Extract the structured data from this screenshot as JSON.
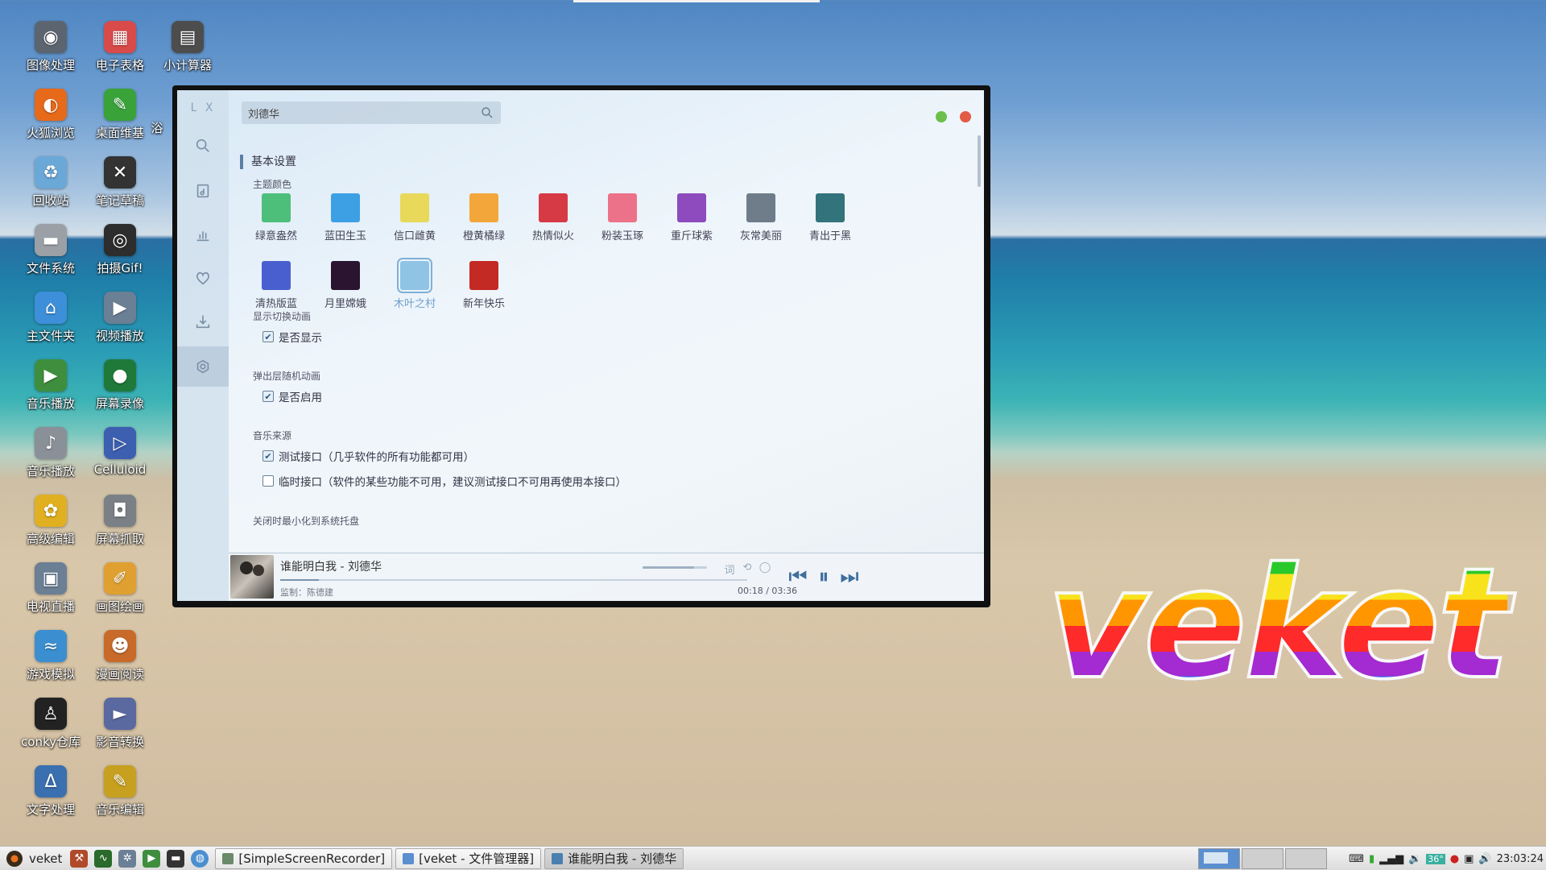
{
  "desktop": {
    "icons": [
      {
        "label": "图像处理",
        "icon": "image-editor-icon",
        "color": "#5c6470",
        "glyph": "◉"
      },
      {
        "label": "电子表格",
        "icon": "spreadsheet-icon",
        "color": "#d94a4a",
        "glyph": "▦"
      },
      {
        "label": "小计算器",
        "icon": "calculator-icon",
        "color": "#4d4d4d",
        "glyph": "▤"
      },
      {
        "label": "火狐浏览",
        "icon": "firefox-icon",
        "color": "#e66a1a",
        "glyph": "◐"
      },
      {
        "label": "桌面维基",
        "icon": "wiki-icon",
        "color": "#39a33a",
        "glyph": "✎"
      },
      {
        "label": "回收站",
        "icon": "trash-icon",
        "color": "#6aa8d8",
        "glyph": "♻"
      },
      {
        "label": "笔记草稿",
        "icon": "notes-icon",
        "color": "#333333",
        "glyph": "✕"
      },
      {
        "label": "文件系统",
        "icon": "drive-icon",
        "color": "#9aa0a6",
        "glyph": "▬"
      },
      {
        "label": "拍摄Gif!",
        "icon": "camera-icon",
        "color": "#2d2d2d",
        "glyph": "◎"
      },
      {
        "label": "主文件夹",
        "icon": "home-folder-icon",
        "color": "#3d8fd9",
        "glyph": "⌂"
      },
      {
        "label": "视频播放",
        "icon": "video-player-icon",
        "color": "#6b7f95",
        "glyph": "▶"
      },
      {
        "label": "音乐播放",
        "icon": "music-player-icon",
        "color": "#3e8e3e",
        "glyph": "▶"
      },
      {
        "label": "屏幕录像",
        "icon": "screen-recorder-icon",
        "color": "#1f7a3a",
        "glyph": "●"
      },
      {
        "label": "音乐播放",
        "icon": "speaker-icon",
        "color": "#8a9098",
        "glyph": "♪"
      },
      {
        "label": "Celluloid",
        "icon": "celluloid-icon",
        "color": "#3d5fb0",
        "glyph": "▷"
      },
      {
        "label": "高级编辑",
        "icon": "advanced-editor-icon",
        "color": "#e0b020",
        "glyph": "✿"
      },
      {
        "label": "屏幕抓取",
        "icon": "screenshot-icon",
        "color": "#7b7f86",
        "glyph": "◘"
      },
      {
        "label": "电视直播",
        "icon": "tv-icon",
        "color": "#6b7f95",
        "glyph": "▣"
      },
      {
        "label": "画图绘画",
        "icon": "paint-icon",
        "color": "#e0a030",
        "glyph": "✐"
      },
      {
        "label": "游戏模拟",
        "icon": "game-emulator-icon",
        "color": "#3b8fd0",
        "glyph": "≈"
      },
      {
        "label": "漫画阅读",
        "icon": "comic-reader-icon",
        "color": "#c86a2a",
        "glyph": "☻"
      },
      {
        "label": "conky仓库",
        "icon": "penguin-icon",
        "color": "#222222",
        "glyph": "♙"
      },
      {
        "label": "影音转换",
        "icon": "media-converter-icon",
        "color": "#5a6aa0",
        "glyph": "►"
      },
      {
        "label": "文字处理",
        "icon": "word-processor-icon",
        "color": "#3a6fb0",
        "glyph": "Δ"
      },
      {
        "label": "音乐编辑",
        "icon": "music-editor-icon",
        "color": "#c8a020",
        "glyph": "✎"
      }
    ],
    "partial_label": "浴"
  },
  "app": {
    "logo": "L X",
    "search_value": "刘德华",
    "section_title": "基本设置",
    "theme_label": "主题颜色",
    "themes": [
      {
        "name": "绿意盎然",
        "color": "#4dbf7a"
      },
      {
        "name": "蓝田生玉",
        "color": "#3ea0e4"
      },
      {
        "name": "信口雌黄",
        "color": "#e9d95a"
      },
      {
        "name": "橙黄橘绿",
        "color": "#f3a73b"
      },
      {
        "name": "热情似火",
        "color": "#d63a45"
      },
      {
        "name": "粉装玉琢",
        "color": "#ec7289"
      },
      {
        "name": "重斤球紫",
        "color": "#8d4bbd"
      },
      {
        "name": "灰常美丽",
        "color": "#6e7d89"
      },
      {
        "name": "青出于黑",
        "color": "#33737b"
      },
      {
        "name": "清热版蓝",
        "color": "#4a5fcf"
      },
      {
        "name": "月里嫦娥",
        "color": "#2a1430"
      },
      {
        "name": "木叶之村",
        "color": "#8fc4e4"
      },
      {
        "name": "新年快乐",
        "color": "#c32a23"
      }
    ],
    "selected_theme": "木叶之村",
    "anim_label": "显示切换动画",
    "anim_option": "是否显示",
    "popup_label": "弹出层随机动画",
    "popup_option": "是否启用",
    "source_label": "音乐来源",
    "source_test": "测试接口（几乎软件的所有功能都可用）",
    "source_temp": "临时接口（软件的某些功能不可用，建议测试接口不可用再使用本接口）",
    "cut_label": "关闭时最小化到系统托盘",
    "player": {
      "title": "谁能明白我 - 刘德华",
      "subtitle": "监制：陈德建",
      "time": "00:18 / 03:36",
      "progress": 0.083,
      "volume": 0.8
    }
  },
  "brand_text": "veket",
  "taskbar": {
    "start_label": "veket",
    "tasks": [
      {
        "label": "[SimpleScreenRecorder]",
        "icon_color": "#6a8a6a"
      },
      {
        "label": "[veket - 文件管理器]",
        "icon_color": "#5a8fd0"
      },
      {
        "label": "谁能明白我 - 刘德华",
        "icon_color": "#4a7fb0"
      }
    ],
    "temperature": "36°",
    "clock": "23:03:24"
  }
}
